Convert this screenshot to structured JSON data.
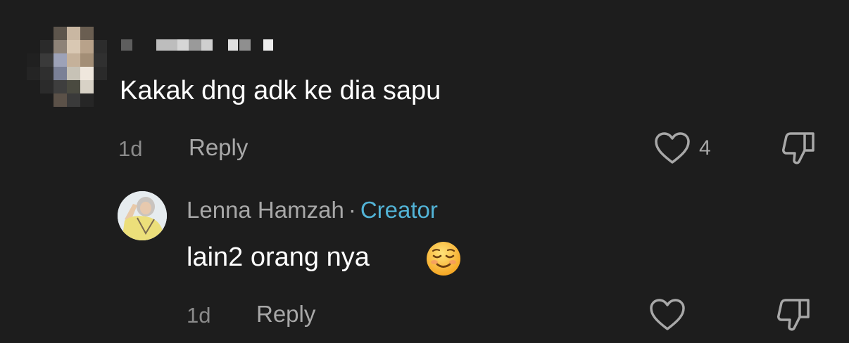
{
  "comments": [
    {
      "author": "",
      "text": "Kakak dng adk ke dia sapu",
      "time": "1d",
      "reply_label": "Reply",
      "like_count": "4"
    },
    {
      "author": "Lenna Hamzah",
      "separator": "·",
      "badge": "Creator",
      "text": "lain2 orang nya",
      "emoji": "☺️",
      "time": "1d",
      "reply_label": "Reply"
    }
  ],
  "colors": {
    "background": "#1d1d1d",
    "creator_badge": "#52b3d6",
    "muted_text": "#a8a8a8"
  },
  "icons": {
    "like": "heart-outline-icon",
    "dislike": "thumbs-down-outline-icon"
  }
}
